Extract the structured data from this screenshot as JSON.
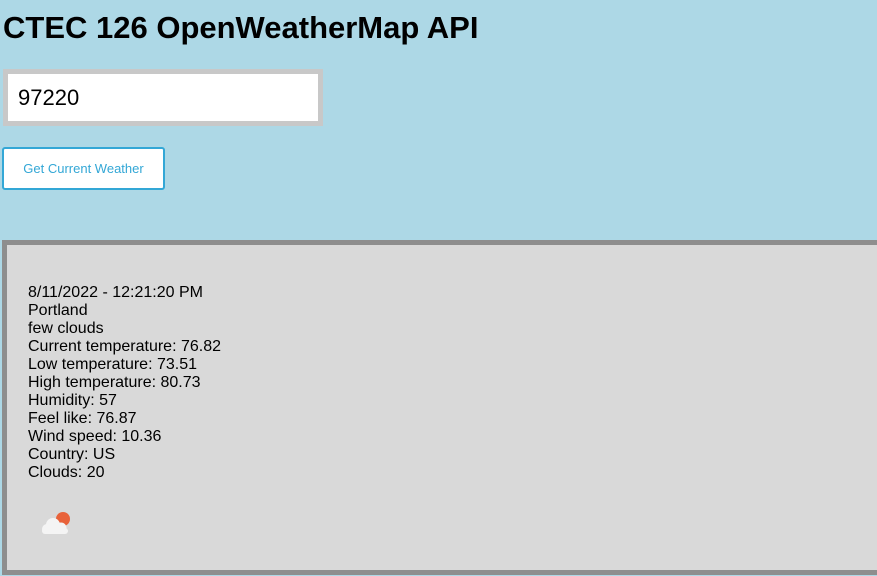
{
  "page": {
    "title": "CTEC 126 OpenWeatherMap API"
  },
  "form": {
    "zip_value": "97220",
    "button_label": "Get Current Weather"
  },
  "weather": {
    "datetime": "8/11/2022 - 12:21:20 PM",
    "city": "Portland",
    "description": "few clouds",
    "current_temp": "Current temperature: 76.82",
    "low_temp": "Low temperature: 73.51",
    "high_temp": "High temperature: 80.73",
    "humidity": "Humidity: 57",
    "feels_like": "Feel like: 76.87",
    "wind_speed": "Wind speed: 10.36",
    "country": "Country: US",
    "clouds": "Clouds: 20",
    "icon": "few-clouds-day-icon"
  },
  "colors": {
    "background": "#add8e6",
    "panel": "#d9d9d9",
    "panel_border": "#8e8e8e",
    "button_accent": "#33a7d6",
    "sun": "#e8623a"
  }
}
